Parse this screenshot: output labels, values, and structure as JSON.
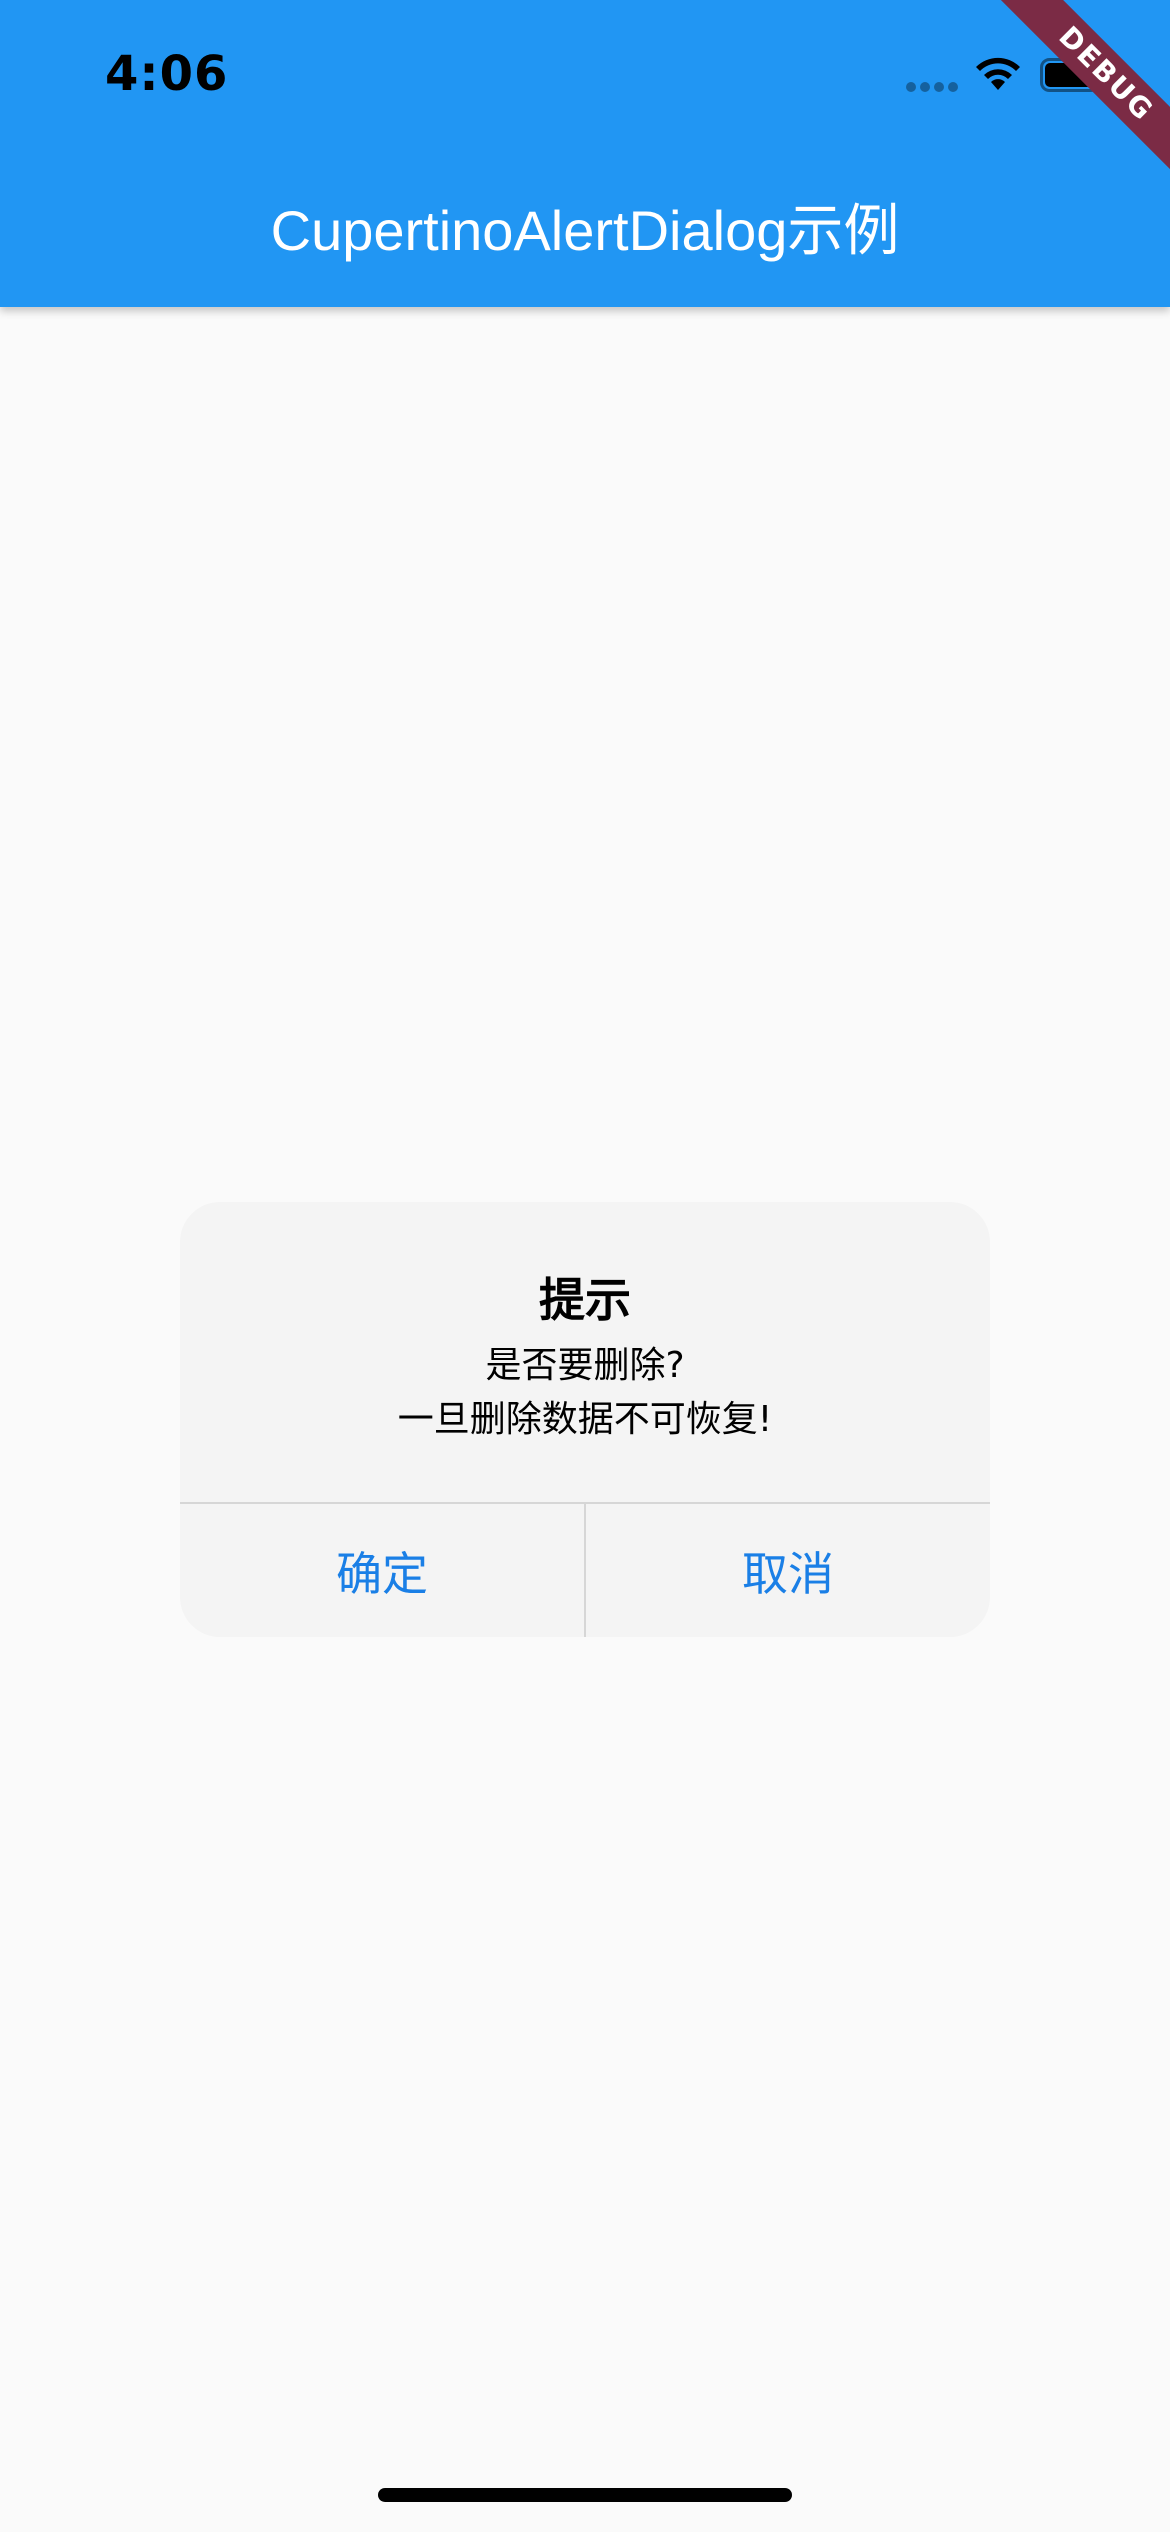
{
  "status_bar": {
    "time": "4:06"
  },
  "app_bar": {
    "title": "CupertinoAlertDialog示例",
    "color": "#2196f3"
  },
  "debug_banner": {
    "label": "DEBUG"
  },
  "dialog": {
    "title": "提示",
    "message_line1": "是否要删除?",
    "message_line2": "一旦删除数据不可恢复!",
    "actions": [
      {
        "label": "确定"
      },
      {
        "label": "取消"
      }
    ],
    "action_color": "#1a7fe6"
  },
  "icons": {
    "signal": "cellular-signal-icon",
    "wifi": "wifi-icon",
    "battery": "battery-icon"
  }
}
